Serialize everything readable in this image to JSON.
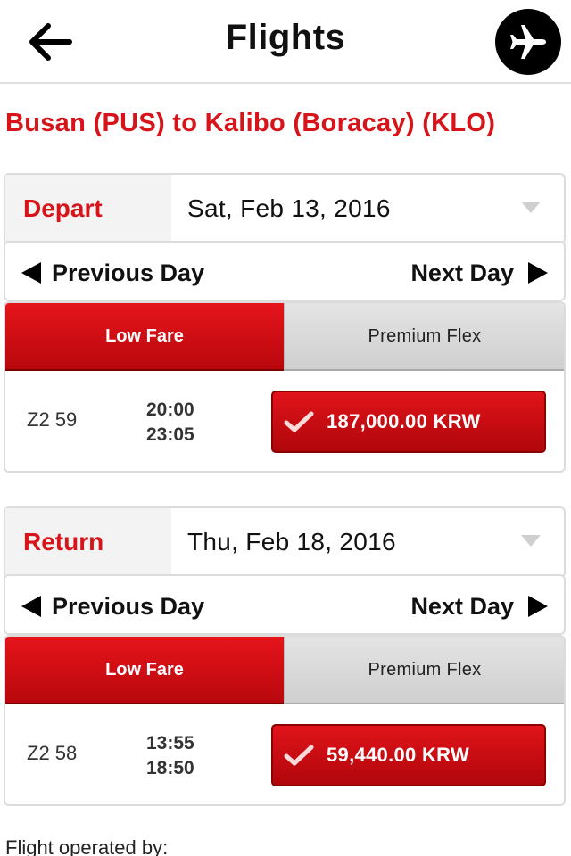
{
  "header": {
    "title": "Flights",
    "back_icon": "arrow-left-icon",
    "plane_icon": "airplane-icon"
  },
  "route": "Busan (PUS) to Kalibo (Boracay) (KLO)",
  "depart": {
    "label": "Depart",
    "date": "Sat, Feb 13, 2016",
    "prev_day": "Previous Day",
    "next_day": "Next Day",
    "tabs": {
      "low_fare": "Low Fare",
      "premium_flex": "Premium Flex"
    },
    "flight": {
      "number": "Z2 59",
      "depart_time": "20:00",
      "arrive_time": "23:05",
      "price": "187,000.00 KRW"
    }
  },
  "return": {
    "label": "Return",
    "date": "Thu, Feb 18, 2016",
    "prev_day": "Previous Day",
    "next_day": "Next Day",
    "tabs": {
      "low_fare": "Low Fare",
      "premium_flex": "Premium Flex"
    },
    "flight": {
      "number": "Z2 58",
      "depart_time": "13:55",
      "arrive_time": "18:50",
      "price": "59,440.00 KRW"
    }
  },
  "footer": {
    "operated_by": "Flight operated by:"
  },
  "colors": {
    "brand_red": "#d7141a",
    "dark_red": "#b0060b",
    "label_bg": "#f3f3f3"
  }
}
